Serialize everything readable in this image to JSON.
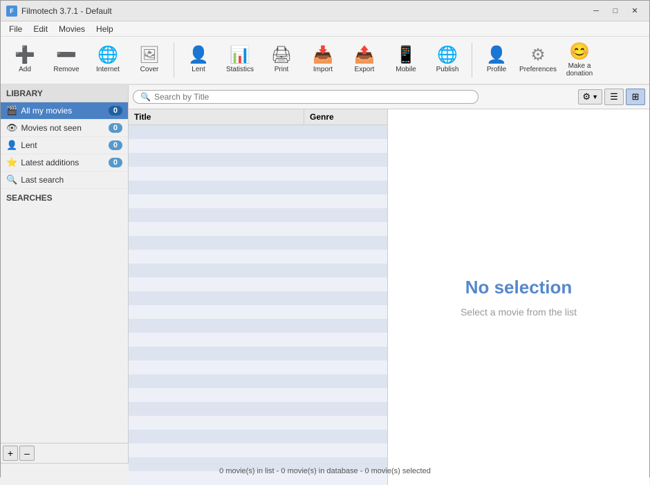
{
  "app": {
    "title": "Filmotech 3.7.1 - Default",
    "icon_label": "F"
  },
  "window_controls": {
    "minimize": "─",
    "maximize": "□",
    "close": "✕"
  },
  "menubar": {
    "items": [
      "File",
      "Edit",
      "Movies",
      "Help"
    ]
  },
  "toolbar": {
    "buttons": [
      {
        "name": "add",
        "label": "Add",
        "icon": "➕",
        "color_class": "icon-add"
      },
      {
        "name": "remove",
        "label": "Remove",
        "icon": "➖",
        "color_class": "icon-remove"
      },
      {
        "name": "internet",
        "label": "Internet",
        "icon": "🌐",
        "color_class": "icon-internet"
      },
      {
        "name": "cover",
        "label": "Cover",
        "icon": "🖼",
        "color_class": "icon-cover"
      },
      {
        "name": "lend",
        "label": "Lent",
        "icon": "👤",
        "color_class": "icon-lend"
      },
      {
        "name": "statistics",
        "label": "Statistics",
        "icon": "📊",
        "color_class": "icon-stats"
      },
      {
        "name": "print",
        "label": "Print",
        "icon": "🖨",
        "color_class": "icon-print"
      },
      {
        "name": "import",
        "label": "Import",
        "icon": "📥",
        "color_class": "icon-import"
      },
      {
        "name": "export",
        "label": "Export",
        "icon": "📤",
        "color_class": "icon-export"
      },
      {
        "name": "mobile",
        "label": "Mobile",
        "icon": "📱",
        "color_class": "icon-mobile"
      },
      {
        "name": "publish",
        "label": "Publish",
        "icon": "🌐",
        "color_class": "icon-publish"
      },
      {
        "name": "profile",
        "label": "Profile",
        "icon": "👤",
        "color_class": "icon-profile"
      },
      {
        "name": "preferences",
        "label": "Preferences",
        "icon": "⚙",
        "color_class": "icon-prefs"
      },
      {
        "name": "donate",
        "label": "Make a donation",
        "icon": "😊",
        "color_class": "icon-donate"
      }
    ]
  },
  "sidebar": {
    "library_header": "LIBRARY",
    "items": [
      {
        "name": "all-my-movies",
        "label": "All my movies",
        "count": "0",
        "icon": "🎬",
        "active": true
      },
      {
        "name": "movies-not-seen",
        "label": "Movies not seen",
        "count": "0",
        "icon": "👁",
        "active": false
      },
      {
        "name": "lent",
        "label": "Lent",
        "count": "0",
        "icon": "👤",
        "active": false
      },
      {
        "name": "latest-additions",
        "label": "Latest additions",
        "count": "0",
        "icon": "⭐",
        "active": false
      },
      {
        "name": "last-search",
        "label": "Last search",
        "icon": "🔍",
        "active": false
      }
    ],
    "searches_header": "SEARCHES",
    "add_btn": "+",
    "remove_btn": "–"
  },
  "search": {
    "placeholder": "Search by Title",
    "search_icon": "🔍",
    "settings_icon": "⚙",
    "settings_dropdown": "▼"
  },
  "list": {
    "columns": [
      "Title",
      "Genre"
    ],
    "rows": []
  },
  "detail": {
    "no_selection_title": "No selection",
    "no_selection_subtitle": "Select a movie from the list"
  },
  "statusbar": {
    "text": "0 movie(s) in list - 0 movie(s) in database - 0 movie(s) selected"
  }
}
